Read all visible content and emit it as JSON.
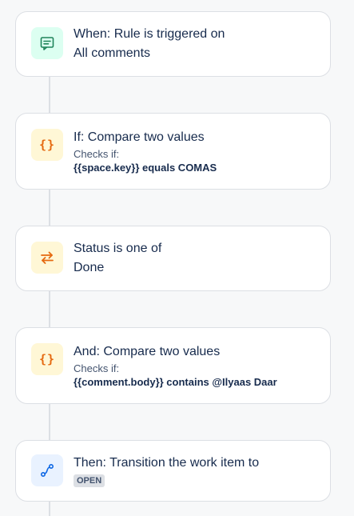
{
  "colors": {
    "trigger_tile": "#dcfff1",
    "trigger_icon": "#1f845a",
    "condition_tile": "#fff7d6",
    "condition_icon": "#e56910",
    "action_tile": "#e9f2ff",
    "action_icon": "#0c66e4",
    "connector": "#dcdfe4"
  },
  "steps": [
    {
      "icon": "comment-icon",
      "title": "When: Rule is triggered on",
      "detail": "All comments"
    },
    {
      "icon": "curly-braces-icon",
      "icon_text": "{}",
      "title": "If: Compare two values",
      "caption": "Checks if:",
      "expression": "{{space.key}} equals COMAS"
    },
    {
      "icon": "swap-arrows-icon",
      "title": "Status is one of",
      "detail": "Done"
    },
    {
      "icon": "curly-braces-icon",
      "icon_text": "{}",
      "title": "And: Compare two values",
      "caption": "Checks if:",
      "expression": "{{comment.body}} contains @Ilyaas Daar"
    },
    {
      "icon": "transition-icon",
      "title": "Then: Transition the work item to",
      "status": "OPEN"
    }
  ]
}
